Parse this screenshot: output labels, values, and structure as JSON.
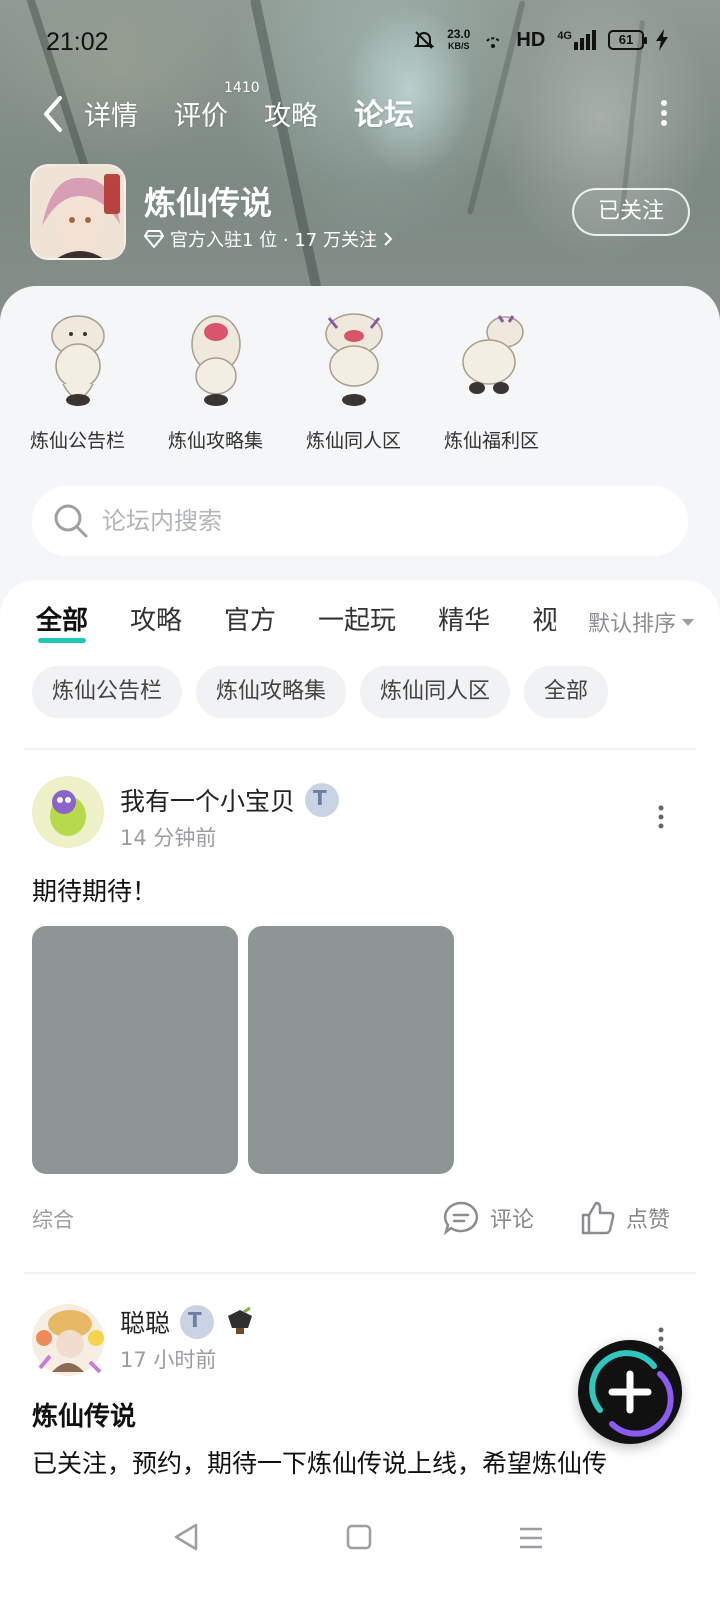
{
  "status_bar": {
    "time": "21:02",
    "net_speed_value": "23.0",
    "net_speed_unit": "KB/S",
    "hd": "HD",
    "signal_type": "4G",
    "battery": "61"
  },
  "nav": {
    "tabs": [
      {
        "label": "详情"
      },
      {
        "label": "评价",
        "count": "1410"
      },
      {
        "label": "攻略"
      },
      {
        "label": "论坛",
        "active": true
      }
    ]
  },
  "app": {
    "title": "炼仙传说",
    "subtitle": "官方入驻1 位 · 17 万关注",
    "follow_label": "已关注"
  },
  "subforums": [
    {
      "label": "炼仙公告栏"
    },
    {
      "label": "炼仙攻略集"
    },
    {
      "label": "炼仙同人区"
    },
    {
      "label": "炼仙福利区"
    }
  ],
  "search": {
    "placeholder": "论坛内搜索"
  },
  "category_tabs": [
    "全部",
    "攻略",
    "官方",
    "一起玩",
    "精华",
    "视"
  ],
  "sort_label": "默认排序",
  "chips": [
    "炼仙公告栏",
    "炼仙攻略集",
    "炼仙同人区",
    "全部"
  ],
  "posts": [
    {
      "author": "我有一个小宝贝",
      "time": "14 分钟前",
      "text": "期待期待！",
      "tag": "综合",
      "comment_label": "评论",
      "like_label": "点赞"
    },
    {
      "author": "聪聪",
      "time": "17 小时前",
      "title": "炼仙传说",
      "text": "已关注，预约，期待一下炼仙传说上线，希望炼仙传"
    }
  ],
  "colors": {
    "accent": "#1fc7b6",
    "tab_highlight": "#27d1c3",
    "image_placeholder": "#8f9594"
  }
}
